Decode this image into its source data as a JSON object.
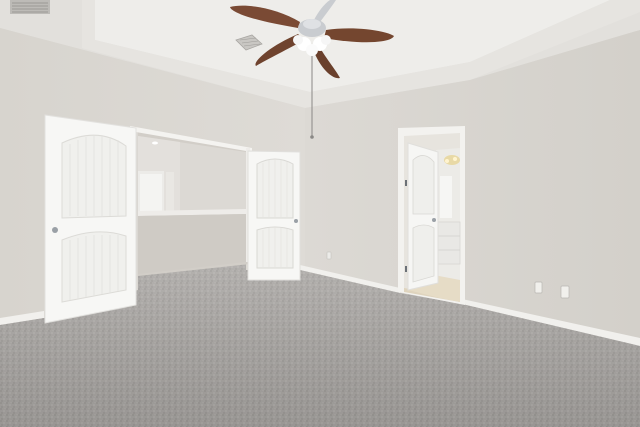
{
  "scene": {
    "colors": {
      "wall": "#dcd9d3",
      "wall_shadow": "#cfcbc4",
      "ceiling": "#e4e2de",
      "tray": "#ecebe8",
      "carpet": "#a9a6a3",
      "door": "#f7f7f5",
      "trim": "#f3f2ef",
      "fan_blade": "#7a4a34",
      "fan_metal": "#c9ccd0",
      "bath_light": "#e8d69a"
    },
    "elements": [
      "ceiling-fan",
      "air-vent",
      "double-doors",
      "closet-opening",
      "bathroom-door",
      "electrical-outlets",
      "carpet-floor"
    ]
  }
}
